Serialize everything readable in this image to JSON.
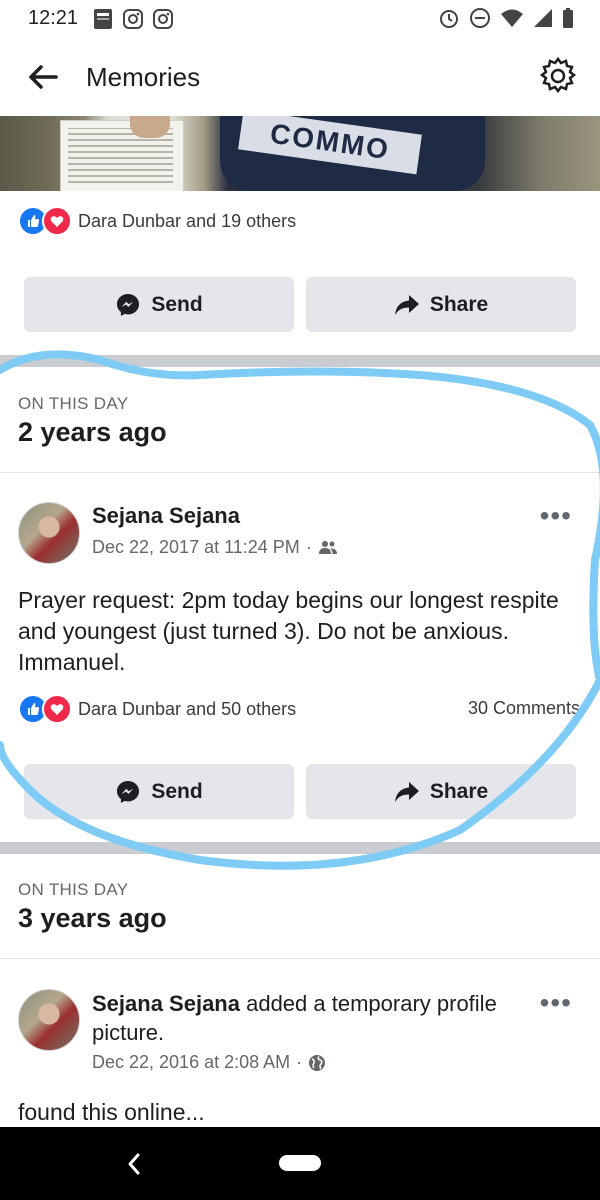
{
  "status_bar": {
    "time": "12:21"
  },
  "header": {
    "title": "Memories"
  },
  "photo": {
    "shirt_text": "COMMO"
  },
  "memory1": {
    "reactions_text": "Dara Dunbar and 19 others",
    "send_label": "Send",
    "share_label": "Share"
  },
  "memory2": {
    "label": "ON THIS DAY",
    "title": "2 years ago",
    "author": "Sejana Sejana",
    "timestamp": "Dec 22, 2017 at 11:24 PM",
    "audience_icon": "friends-icon",
    "text": "Prayer request: 2pm today begins our longest respite and youngest (just turned 3). Do not be anxious. Immanuel.",
    "reactions_text": "Dara Dunbar and 50 others",
    "comments": "30 Comments",
    "send_label": "Send",
    "share_label": "Share"
  },
  "memory3": {
    "label": "ON THIS DAY",
    "title": "3 years ago",
    "author": "Sejana Sejana",
    "action": " added a temporary profile picture.",
    "timestamp": "Dec 22, 2016 at 2:08 AM",
    "audience_icon": "globe-icon",
    "text": "found this online..."
  },
  "colors": {
    "like": "#1877f2",
    "love": "#f02849",
    "button_bg": "#e4e6eb",
    "annotation": "#7ecbf5"
  }
}
